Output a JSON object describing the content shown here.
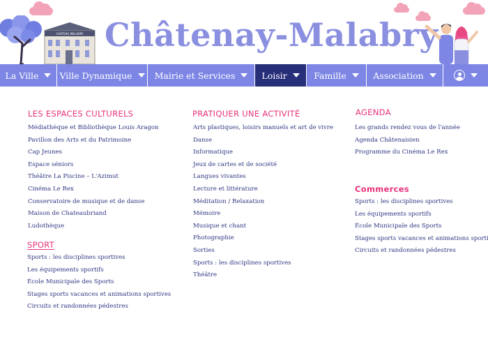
{
  "header": {
    "site_title": "Châtenay-Malabry",
    "castle_sign": "CHATEAU MALABRY"
  },
  "nav": {
    "items": [
      {
        "label": "La Ville"
      },
      {
        "label": "Ville Dynamique"
      },
      {
        "label": "Mairie et Services"
      },
      {
        "label": "Loisir"
      },
      {
        "label": "Famille"
      },
      {
        "label": "Association"
      }
    ],
    "active": "Loisir",
    "user_icon": "user-circle-icon"
  },
  "colors": {
    "nav_bg": "#7d86e4",
    "nav_active": "#272e7a",
    "heading": "#e6317a",
    "link": "#2e3580",
    "title": "#8a8fe0",
    "cloud": "#f2a3b8"
  },
  "espaces": {
    "heading": "LES ESPACES CULTURELS",
    "links": [
      "Médiathèque et Bibliothèque Louis Aragon",
      "Pavillon des Arts et du Patrimoine",
      "Cap Jeunes",
      "Espace séniors",
      "Théâtre La Piscine – L'Azimut",
      "Cinéma Le Rex",
      "Conservatoire de musique et de danse",
      "Maison de Chateaubriand",
      "Ludothèque"
    ]
  },
  "sport": {
    "heading": "SPORT",
    "links": [
      "Sports : les disciplines sportives",
      "Les équipements sportifs",
      "École Municipale des Sports",
      "Stages sports vacances et animations sportives",
      "Circuits et randonnées pédestres"
    ]
  },
  "activite": {
    "heading": "PRATIQUER UNE ACTIVITÉ",
    "links": [
      "Arts plastiques, loisirs manuels et art de vivre",
      "Danse",
      "Informatique",
      "Jeux de cartes et de société",
      "Langues vivantes",
      "Lecture et littérature",
      "Méditation / Relaxation",
      "Mémoire",
      "Musique et chant",
      "Photographie",
      "Sorties",
      "Sports : les disciplines sportives",
      "Théâtre"
    ]
  },
  "agenda": {
    "heading": "AGENDA",
    "links": [
      "Les grands rendez vous de l'année",
      "Agenda Châtenaisien",
      "Programme du Cinéma Le Rex"
    ]
  },
  "commerces": {
    "heading": "Commerces",
    "links": [
      "Sports : les disciplines sportives",
      "Les équipements sportifs",
      "École Municipale des Sports",
      "Stages sports vacances et animations sportives",
      "Circuits et randonnées pédestres"
    ]
  }
}
